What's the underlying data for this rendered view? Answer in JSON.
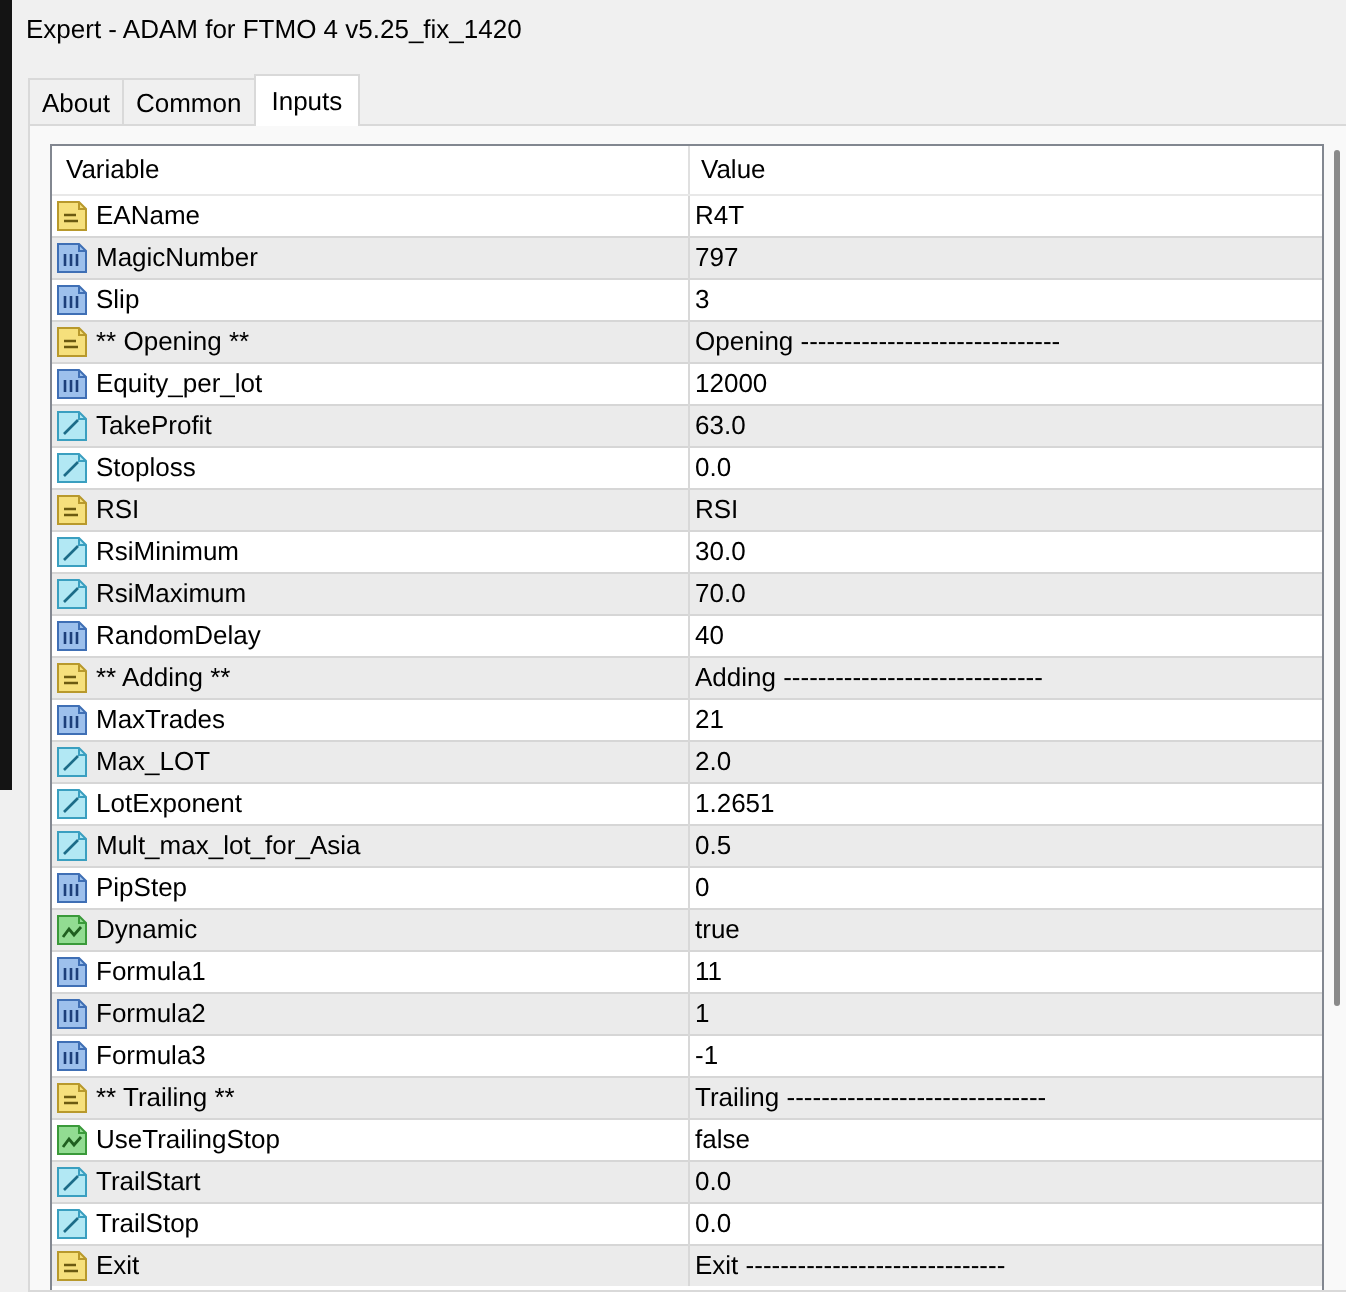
{
  "window": {
    "title": "Expert - ADAM for FTMO 4 v5.25_fix_1420"
  },
  "tabs": [
    {
      "label": "About",
      "selected": false
    },
    {
      "label": "Common",
      "selected": false
    },
    {
      "label": "Inputs",
      "selected": true
    }
  ],
  "table": {
    "columns": [
      "Variable",
      "Value"
    ],
    "rows": [
      {
        "kind": "string",
        "variable": "EAName",
        "value": "R4T"
      },
      {
        "kind": "int",
        "variable": "MagicNumber",
        "value": "797"
      },
      {
        "kind": "int",
        "variable": "Slip",
        "value": "3"
      },
      {
        "kind": "string",
        "variable": "** Opening **",
        "value": "Opening ------------------------------"
      },
      {
        "kind": "int",
        "variable": "Equity_per_lot",
        "value": "12000"
      },
      {
        "kind": "double",
        "variable": "TakeProfit",
        "value": "63.0"
      },
      {
        "kind": "double",
        "variable": "Stoploss",
        "value": "0.0"
      },
      {
        "kind": "string",
        "variable": "RSI",
        "value": "RSI"
      },
      {
        "kind": "double",
        "variable": "RsiMinimum",
        "value": "30.0"
      },
      {
        "kind": "double",
        "variable": "RsiMaximum",
        "value": "70.0"
      },
      {
        "kind": "int",
        "variable": "RandomDelay",
        "value": "40"
      },
      {
        "kind": "string",
        "variable": "** Adding **",
        "value": "Adding ------------------------------"
      },
      {
        "kind": "int",
        "variable": "MaxTrades",
        "value": "21"
      },
      {
        "kind": "double",
        "variable": "Max_LOT",
        "value": "2.0"
      },
      {
        "kind": "double",
        "variable": "LotExponent",
        "value": "1.2651"
      },
      {
        "kind": "double",
        "variable": "Mult_max_lot_for_Asia",
        "value": "0.5"
      },
      {
        "kind": "int",
        "variable": "PipStep",
        "value": "0"
      },
      {
        "kind": "bool",
        "variable": "Dynamic",
        "value": "true"
      },
      {
        "kind": "int",
        "variable": "Formula1",
        "value": "11"
      },
      {
        "kind": "int",
        "variable": "Formula2",
        "value": "1"
      },
      {
        "kind": "int",
        "variable": "Formula3",
        "value": "-1"
      },
      {
        "kind": "string",
        "variable": "** Trailing **",
        "value": "Trailing ------------------------------"
      },
      {
        "kind": "bool",
        "variable": "UseTrailingStop",
        "value": "false"
      },
      {
        "kind": "double",
        "variable": "TrailStart",
        "value": "0.0"
      },
      {
        "kind": "double",
        "variable": "TrailStop",
        "value": "0.0"
      },
      {
        "kind": "string",
        "variable": "Exit",
        "value": "Exit ------------------------------"
      }
    ]
  }
}
